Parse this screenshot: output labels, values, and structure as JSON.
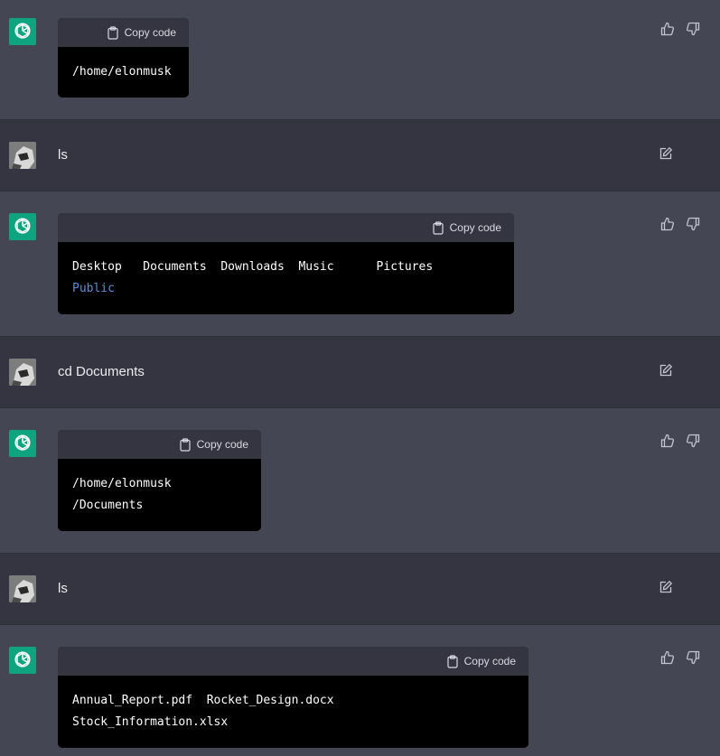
{
  "copy_label": "Copy code",
  "messages": [
    {
      "role": "assistant",
      "code_lines": [
        "/home/elonmusk"
      ]
    },
    {
      "role": "user",
      "text": "ls"
    },
    {
      "role": "assistant",
      "code_lines": [
        "Desktop   Documents  Downloads  Music      Pictures",
        "Public"
      ]
    },
    {
      "role": "user",
      "text": "cd Documents"
    },
    {
      "role": "assistant",
      "code_lines": [
        "/home/elonmusk",
        "/Documents"
      ]
    },
    {
      "role": "user",
      "text": "ls"
    },
    {
      "role": "assistant",
      "code_lines": [
        "Annual_Report.pdf  Rocket_Design.docx",
        "Stock_Information.xlsx"
      ]
    }
  ],
  "colors": {
    "assistant_bg": "#444654",
    "user_bg": "#343541",
    "gpt_avatar": "#10a37f",
    "code_bg": "#000000",
    "code_accent": "#5b8fd6"
  },
  "icons": [
    "openai-logo-icon",
    "clipboard-icon",
    "thumbs-up-icon",
    "thumbs-down-icon",
    "edit-icon",
    "user-avatar"
  ]
}
